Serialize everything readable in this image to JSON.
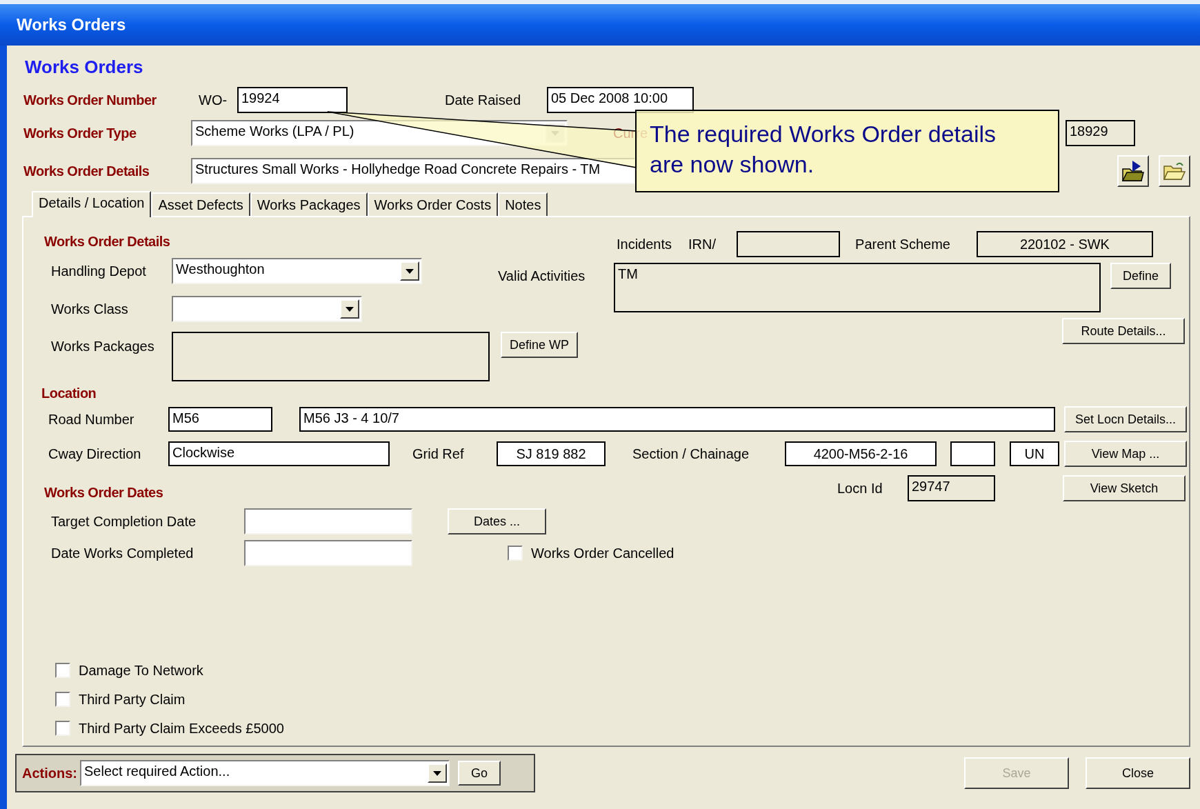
{
  "window": {
    "title": "Works Orders"
  },
  "heading": "Works Orders",
  "header": {
    "number": {
      "label": "Works Order Number",
      "prefix": "WO-",
      "value": "19924"
    },
    "date_raised": {
      "label": "Date Raised",
      "value": "05 Dec 2008 10:00"
    },
    "type": {
      "label": "Works Order Type",
      "value": "Scheme Works (LPA / PL)",
      "disabled": true
    },
    "current_status": {
      "label": "Curre"
    },
    "related_number": {
      "value": "18929"
    },
    "details": {
      "label": "Works Order Details",
      "value": "Structures Small Works - Hollyhedge Road Concrete Repairs - TM"
    }
  },
  "callout": {
    "text": "The required Works Order details are now shown."
  },
  "tabs": [
    {
      "label": "Details / Location",
      "selected": true
    },
    {
      "label": "Asset Defects",
      "selected": false
    },
    {
      "label": "Works Packages",
      "selected": false
    },
    {
      "label": "Works Order Costs",
      "selected": false
    },
    {
      "label": "Notes",
      "selected": false
    }
  ],
  "details_section": {
    "title": "Works Order Details",
    "handling_depot": {
      "label": "Handling Depot",
      "value": "Westhoughton"
    },
    "works_class": {
      "label": "Works Class"
    },
    "works_packages": {
      "label": "Works Packages",
      "button": "Define WP"
    },
    "incidents": {
      "label": "Incidents",
      "irn_label": "IRN/"
    },
    "parent_scheme": {
      "label": "Parent Scheme",
      "value": "220102 - SWK"
    },
    "valid_activities": {
      "label": "Valid Activities",
      "value": "TM",
      "button": "Define"
    },
    "route_button": "Route Details..."
  },
  "location": {
    "title": "Location",
    "road_number": {
      "label": "Road Number",
      "value": "M56",
      "description": "M56 J3 - 4 10/7",
      "button": "Set Locn Details..."
    },
    "cway_direction": {
      "label": "Cway Direction",
      "value": "Clockwise"
    },
    "grid_ref": {
      "label": "Grid Ref",
      "value": "SJ 819 882"
    },
    "section": {
      "label": "Section / Chainage",
      "value": "4200-M56-2-16",
      "extra": "UN",
      "button": "View Map ..."
    }
  },
  "dates": {
    "title": "Works Order Dates",
    "locn_id": {
      "label": "Locn Id",
      "value": "29747",
      "button": "View Sketch"
    },
    "target_completion": {
      "label": "Target Completion Date",
      "button": "Dates ..."
    },
    "date_completed": {
      "label": "Date Works Completed"
    },
    "cancelled": {
      "label": "Works Order Cancelled",
      "checked": false
    }
  },
  "flags": [
    {
      "label": "Damage To Network",
      "checked": false
    },
    {
      "label": "Third Party Claim",
      "checked": false
    },
    {
      "label": "Third Party Claim Exceeds £5000",
      "checked": false
    }
  ],
  "actions": {
    "label": "Actions:",
    "value": "Select required Action...",
    "button": "Go"
  },
  "buttons": [
    {
      "label": "Save",
      "disabled": true
    },
    {
      "label": "Close",
      "disabled": false
    }
  ]
}
